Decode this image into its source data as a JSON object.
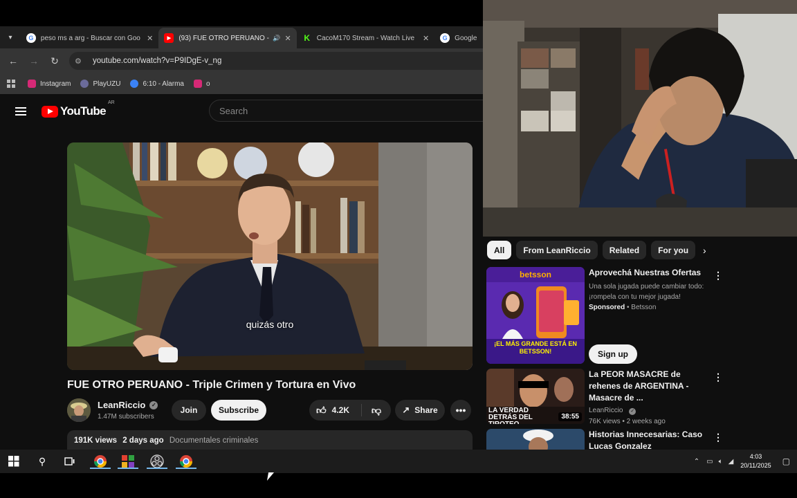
{
  "browser": {
    "tabs": [
      {
        "title": "peso ms a arg - Buscar con Goo",
        "favicon": "google-icon",
        "active": false
      },
      {
        "title": "(93) FUE OTRO PERUANO -",
        "favicon": "youtube-icon",
        "active": true
      },
      {
        "title": "CacoM170 Stream - Watch Live",
        "favicon": "kick-icon",
        "active": false
      },
      {
        "title": "Google",
        "favicon": "google-icon",
        "active": false
      }
    ],
    "url": "youtube.com/watch?v=P9IDgE-v_ng",
    "bookmarks": [
      {
        "label": "Instagram",
        "color": "#d62976"
      },
      {
        "label": "PlayUZU",
        "color": "#6b6b9a"
      },
      {
        "label": "6:10 - Alarma",
        "color": "#3b82f6"
      },
      {
        "label": "o",
        "color": "#d62976"
      }
    ]
  },
  "youtube": {
    "logo_text": "YouTube",
    "country": "AR",
    "search_placeholder": "Search",
    "subtitle": "quizás otro",
    "video_title": "FUE OTRO PERUANO - Triple Crimen y Tortura en Vivo",
    "channel_name": "LeanRiccio",
    "subscribers": "1.47M subscribers",
    "join_label": "Join",
    "subscribe_label": "Subscribe",
    "likes": "4.2K",
    "share_label": "Share",
    "views": "191K views",
    "posted": "2 days ago",
    "category": "Documentales criminales"
  },
  "sidebar": {
    "chips": [
      "All",
      "From LeanRiccio",
      "Related",
      "For you"
    ],
    "recs": [
      {
        "title": "Aprovechá Nuestras Ofertas",
        "description": "Una sola jugada puede cambiar todo: ¡rompela con tu mejor jugada!",
        "sponsored": "Sponsored",
        "advertiser": "Betsson",
        "cta": "Sign up",
        "thumb_brand": "betsson",
        "thumb_text": "¡EL MÁS GRANDE ESTÁ EN BETSSON!"
      },
      {
        "title": "La PEOR MASACRE de rehenes de ARGENTINA - Masacre de ...",
        "channel": "LeanRiccio",
        "meta": "76K views • 2 weeks ago",
        "duration": "38:55",
        "thumb_text": "LA VERDAD DETRÁS DEL TIROTEO"
      },
      {
        "title": "Historias Innecesarias: Caso Lucas Gonzalez"
      }
    ]
  },
  "taskbar": {
    "time": "4:03",
    "date": "20/11/2025"
  },
  "colors": {
    "yt_red": "#ff0000",
    "yt_bg": "#0f0f0f",
    "chip_bg": "#272727",
    "taskbar_accent": "#76b9ed"
  }
}
